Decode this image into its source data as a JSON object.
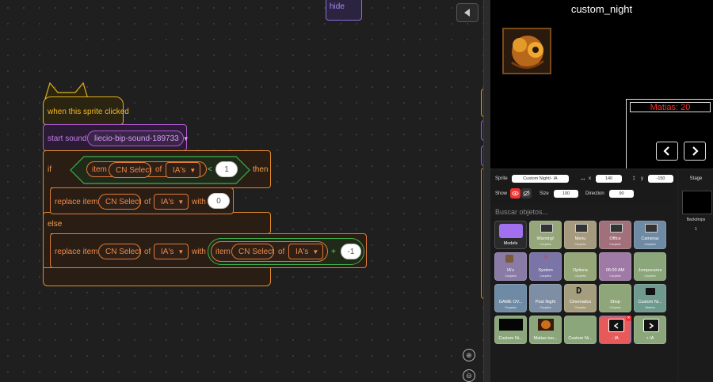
{
  "code": {
    "hide_label": "hide",
    "hat_label": "when this sprite clicked",
    "start_sound_label": "start sound",
    "sound_name": "liecio-bip-sound-189733",
    "if_label": "if",
    "then_label": "then",
    "else_label": "else",
    "item_label": "item",
    "cn_select": "CN Select",
    "of_label": "of",
    "list_name": "IA's",
    "lt_symbol": "<",
    "value_one": "1",
    "replace_label": "replace item",
    "with_label": "with",
    "value_zero": "0",
    "plus_symbol": "+",
    "value_neg_one": "-1"
  },
  "stage": {
    "title": "custom_night",
    "matias_text": "Matias: 20"
  },
  "sprite_info": {
    "sprite_label": "Sprite",
    "sprite_name": "Custom Night/- IA",
    "x_label": "x",
    "x_value": "140",
    "y_label": "y",
    "y_value": "-150",
    "show_label": "Show",
    "size_label": "Size",
    "size_value": "100",
    "direction_label": "Direction",
    "direction_value": "90"
  },
  "sprite_list": {
    "search_placeholder": "Buscar objetos...",
    "tiles": [
      {
        "name": "Models",
        "sub": ""
      },
      {
        "name": "Warning!",
        "sub": "Carpeta"
      },
      {
        "name": "Menu",
        "sub": "Carpeta"
      },
      {
        "name": "Office",
        "sub": "Carpeta"
      },
      {
        "name": "Cameras",
        "sub": "Carpeta"
      },
      {
        "name": "IA's",
        "sub": "Carpeta"
      },
      {
        "name": "System",
        "sub": "Carpeta"
      },
      {
        "name": "Options",
        "sub": "Carpeta"
      },
      {
        "name": "06:00 AM",
        "sub": "Carpeta"
      },
      {
        "name": "Jumpscares",
        "sub": "Carpeta"
      },
      {
        "name": "GAME OV...",
        "sub": "Carpeta"
      },
      {
        "name": "Post Night",
        "sub": "Carpeta"
      },
      {
        "name": "Cinematics",
        "sub": "Carpeta"
      },
      {
        "name": "Shop",
        "sub": "Carpeta"
      },
      {
        "name": "Custom Ni...",
        "sub": "Abierta"
      },
      {
        "name": "Custom Ni...",
        "sub": ""
      },
      {
        "name": "Matias too...",
        "sub": ""
      },
      {
        "name": "Custom Ni...",
        "sub": ""
      },
      {
        "name": "- IA",
        "sub": ""
      },
      {
        "name": "+ IA",
        "sub": ""
      }
    ]
  },
  "stage_side": {
    "title": "Stage",
    "backdrops_label": "Backdrops",
    "backdrops_count": "1"
  }
}
